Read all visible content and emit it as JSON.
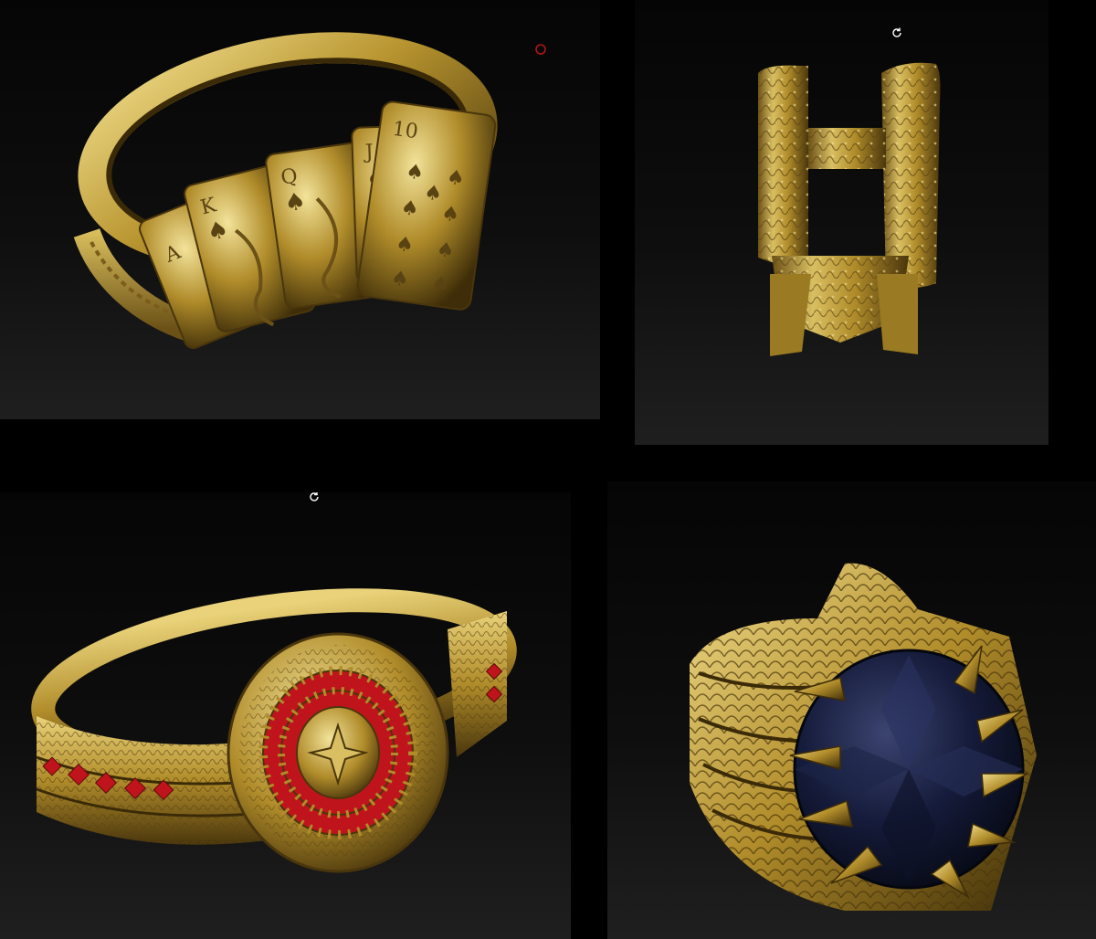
{
  "colors": {
    "background": "#000000",
    "gold": "#b8952f",
    "gold_light": "#e9d27a",
    "gold_dark": "#5a4312",
    "ruby": "#c0141c",
    "sapphire": "#151b3a"
  },
  "panels": [
    {
      "subject": "playing-card-ring",
      "icon": "selection-ring-icon"
    },
    {
      "subject": "ornate-h-pendant",
      "icon": "rotate-icon"
    },
    {
      "subject": "roulette-ring",
      "icon": "rotate-icon"
    },
    {
      "subject": "claw-gemstone-ring",
      "icon": "none"
    }
  ],
  "cards": [
    {
      "rank": "A",
      "suit": "♠"
    },
    {
      "rank": "K",
      "suit": "♠"
    },
    {
      "rank": "Q",
      "suit": "♠"
    },
    {
      "rank": "J",
      "suit": "♠"
    },
    {
      "rank": "10",
      "suit": "♠"
    }
  ]
}
